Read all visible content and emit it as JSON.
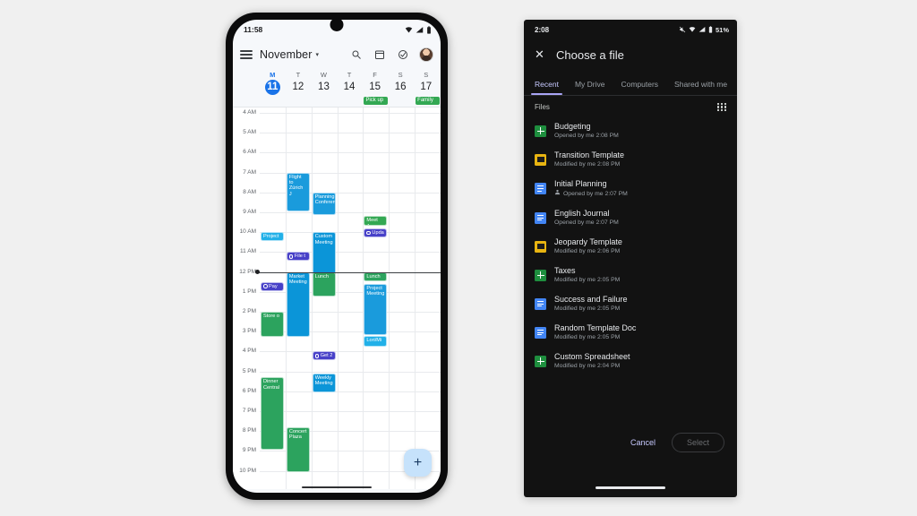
{
  "left_phone": {
    "status": {
      "time": "11:58",
      "icons": [
        "wifi-icon",
        "signal-icon",
        "battery-icon"
      ]
    },
    "toolbar": {
      "menu_icon": "hamburger-menu-icon",
      "month": "November",
      "caret": "▾",
      "search_icon": "search-icon",
      "date_icon": "calendar-date-icon",
      "tasks_icon": "check-circle-icon",
      "avatar": "account-avatar"
    },
    "days": [
      {
        "dow": "M",
        "num": "11",
        "selected": true
      },
      {
        "dow": "T",
        "num": "12",
        "selected": false
      },
      {
        "dow": "W",
        "num": "13",
        "selected": false
      },
      {
        "dow": "T",
        "num": "14",
        "selected": false
      },
      {
        "dow": "F",
        "num": "15",
        "selected": false
      },
      {
        "dow": "S",
        "num": "16",
        "selected": false
      },
      {
        "dow": "S",
        "num": "17",
        "selected": false
      }
    ],
    "allday_events": [
      {
        "col": 4,
        "label": "Pick up",
        "color": "#33a853"
      },
      {
        "col": 6,
        "label": "Family",
        "color": "#33a853"
      }
    ],
    "hours": [
      "4 AM",
      "5 AM",
      "6 AM",
      "7 AM",
      "8 AM",
      "9 AM",
      "10 AM",
      "11 AM",
      "12 PM",
      "1 PM",
      "2 PM",
      "3 PM",
      "4 PM",
      "5 PM",
      "6 PM",
      "7 PM",
      "8 PM",
      "9 PM",
      "10 PM"
    ],
    "now_indicator_hour": "12 PM",
    "events": [
      {
        "col": 1,
        "start": 7.0,
        "end": 9.0,
        "title": "Flight to Zürich J",
        "color": "#1a9bdc",
        "type": "event"
      },
      {
        "col": 2,
        "start": 8.0,
        "end": 9.2,
        "title": "Planning Conferen",
        "color": "#1a9bdc",
        "type": "event"
      },
      {
        "col": 0,
        "start": 10.0,
        "end": 10.5,
        "title": "Project",
        "color": "#21b0e8",
        "type": "event"
      },
      {
        "col": 2,
        "start": 10.0,
        "end": 12.5,
        "title": "Custom Meeting",
        "color": "#0b95d8",
        "type": "event"
      },
      {
        "col": 4,
        "start": 9.2,
        "end": 9.7,
        "title": "Meet Ja",
        "color": "#33a853",
        "type": "event"
      },
      {
        "col": 4,
        "start": 9.8,
        "end": 10.3,
        "title": "Upda",
        "color": "#4740c8",
        "type": "task"
      },
      {
        "col": 1,
        "start": 11.0,
        "end": 11.5,
        "title": "File t",
        "color": "#4740c8",
        "type": "task"
      },
      {
        "col": 0,
        "start": 12.5,
        "end": 13.0,
        "title": "Pay ",
        "color": "#4740c8",
        "type": "task"
      },
      {
        "col": 1,
        "start": 12.0,
        "end": 15.3,
        "title": "Market Meeting",
        "color": "#0b95d8",
        "type": "event"
      },
      {
        "col": 2,
        "start": 12.0,
        "end": 13.3,
        "title": "Lunch",
        "color": "#2ca35e",
        "type": "event"
      },
      {
        "col": 4,
        "start": 12.0,
        "end": 12.5,
        "title": "Lunch w",
        "color": "#2ca35e",
        "type": "event"
      },
      {
        "col": 4,
        "start": 12.6,
        "end": 15.2,
        "title": "Project Meeting",
        "color": "#1a9bdc",
        "type": "event"
      },
      {
        "col": 4,
        "start": 15.2,
        "end": 15.8,
        "title": "Lori/Mi",
        "color": "#21b0e8",
        "type": "event"
      },
      {
        "col": 0,
        "start": 14.0,
        "end": 15.3,
        "title": "Store o",
        "color": "#2ca35e",
        "type": "event"
      },
      {
        "col": 2,
        "start": 16.0,
        "end": 16.5,
        "title": "Get 2",
        "color": "#4740c8",
        "type": "task"
      },
      {
        "col": 2,
        "start": 17.1,
        "end": 18.1,
        "title": "Weekly Meeting",
        "color": "#0b95d8",
        "type": "event"
      },
      {
        "col": 0,
        "start": 17.3,
        "end": 21.0,
        "title": "Dinner Central",
        "color": "#2ca35e",
        "type": "event"
      },
      {
        "col": 1,
        "start": 19.8,
        "end": 22.1,
        "title": "Concert Plaza",
        "color": "#2ca35e",
        "type": "event"
      }
    ],
    "fab": {
      "icon": "plus-icon",
      "label": "+"
    }
  },
  "right_phone": {
    "status": {
      "time": "2:08",
      "battery_text": "51%",
      "icons": [
        "mute-icon",
        "wifi-icon",
        "signal-icon",
        "battery-icon"
      ]
    },
    "header": {
      "close_icon": "close-icon",
      "title": "Choose a file"
    },
    "tabs": [
      {
        "label": "Recent",
        "active": true
      },
      {
        "label": "My Drive",
        "active": false
      },
      {
        "label": "Computers",
        "active": false
      },
      {
        "label": "Shared with me",
        "active": false
      }
    ],
    "files_bar": {
      "label": "Files",
      "view_icon": "grid-view-icon"
    },
    "files": [
      {
        "name": "Budgeting",
        "subtitle": "Opened by me 2:08 PM",
        "icon": "sheets-file-icon",
        "shared": false
      },
      {
        "name": "Transition Template",
        "subtitle": "Modified by me 2:08 PM",
        "icon": "slides-file-icon",
        "shared": false
      },
      {
        "name": "Initial Planning",
        "subtitle": "Opened by me 2:07 PM",
        "icon": "docs-file-icon",
        "shared": true
      },
      {
        "name": "English Journal",
        "subtitle": "Opened by me 2:07 PM",
        "icon": "docs-file-icon",
        "shared": false
      },
      {
        "name": "Jeopardy Template",
        "subtitle": "Modified by me 2:06 PM",
        "icon": "slides-file-icon",
        "shared": false
      },
      {
        "name": "Taxes",
        "subtitle": "Modified by me 2:05 PM",
        "icon": "sheets-file-icon",
        "shared": false
      },
      {
        "name": "Success and Failure",
        "subtitle": "Modified by me 2:05 PM",
        "icon": "docs-file-icon",
        "shared": false
      },
      {
        "name": "Random Template Doc",
        "subtitle": "Modified by me 2:05 PM",
        "icon": "docs-file-icon",
        "shared": false
      },
      {
        "name": "Custom Spreadsheet",
        "subtitle": "Modified by me 2:04 PM",
        "icon": "sheets-file-icon",
        "shared": false
      }
    ],
    "footer": {
      "cancel": "Cancel",
      "select": "Select"
    }
  },
  "colors": {
    "accent_blue": "#1a73e8",
    "event_blue": "#0b95d8",
    "event_green": "#2ca35e",
    "task_purple": "#4740c8",
    "dark_bg": "#121212",
    "tab_accent": "#a8a4f5"
  }
}
